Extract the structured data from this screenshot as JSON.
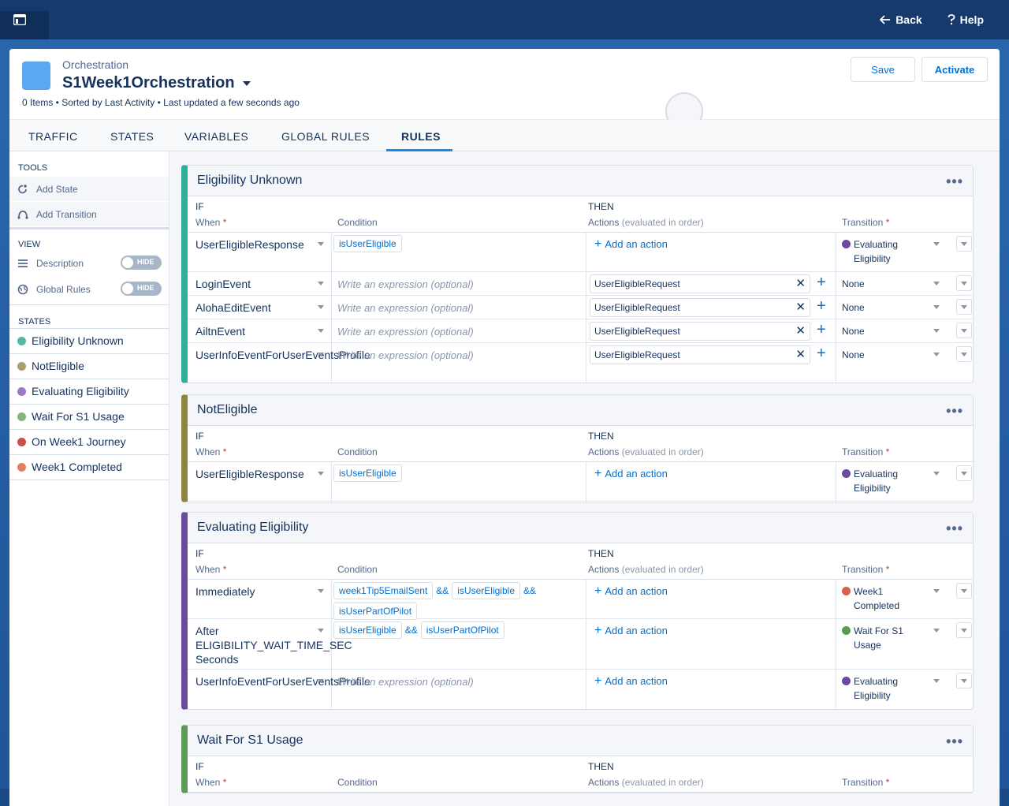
{
  "topnav": {
    "back_label": "Back",
    "help_label": "Help"
  },
  "header": {
    "object_type": "Orchestration",
    "title": "S1Week1Orchestration",
    "meta": "0 Items • Sorted by Last Activity • Last updated a few seconds ago",
    "save_label": "Save",
    "activate_label": "Activate"
  },
  "tabs": [
    "TRAFFIC",
    "STATES",
    "VARIABLES",
    "GLOBAL RULES",
    "RULES"
  ],
  "active_tab": "RULES",
  "sidebar": {
    "tools_heading": "TOOLS",
    "tools": [
      "Add State",
      "Add Transition"
    ],
    "view_heading": "VIEW",
    "view": [
      {
        "label": "Description",
        "toggle": "HIDE"
      },
      {
        "label": "Global Rules",
        "toggle": "HIDE"
      }
    ],
    "states_heading": "STATES",
    "states": [
      {
        "label": "Eligibility Unknown",
        "color": "#55b8a2"
      },
      {
        "label": "NotEligible",
        "color": "#a8a071"
      },
      {
        "label": "Evaluating Eligibility",
        "color": "#9b7bc4"
      },
      {
        "label": "Wait For S1 Usage",
        "color": "#85b47e"
      },
      {
        "label": "On Week1 Journey",
        "color": "#c6504a"
      },
      {
        "label": "Week1 Completed",
        "color": "#e07f62"
      }
    ]
  },
  "labels": {
    "if": "IF",
    "then": "THEN",
    "when": "When",
    "condition": "Condition",
    "actions": "Actions",
    "actions_note": "(evaluated in order)",
    "transition": "Transition",
    "required": "*",
    "placeholder": "Write an expression (optional)",
    "add_action": "Add an action",
    "more": "•••"
  },
  "cards": [
    {
      "title": "Eligibility Unknown",
      "color": "#2fae9d",
      "rows": [
        {
          "when": "UserEligibleResponse",
          "cond": [
            "isUserEligible"
          ],
          "action": null,
          "transition": "Evaluating Eligibility",
          "tcolor": "#6b4a9e"
        },
        {
          "when": "LoginEvent",
          "cond": null,
          "action": "UserEligibleRequest",
          "transition": "None",
          "tcolor": null
        },
        {
          "when": "AlohaEditEvent",
          "cond": null,
          "action": "UserEligibleRequest",
          "transition": "None",
          "tcolor": null
        },
        {
          "when": "AiltnEvent",
          "cond": null,
          "action": "UserEligibleRequest",
          "transition": "None",
          "tcolor": null
        },
        {
          "when": "UserInfoEventForUserEventsProfile",
          "cond": null,
          "action": "UserEligibleRequest",
          "transition": "None",
          "tcolor": null
        }
      ]
    },
    {
      "title": "NotEligible",
      "color": "#8f8440",
      "rows": [
        {
          "when": "UserEligibleResponse",
          "cond": [
            "isUserEligible"
          ],
          "action": null,
          "transition": "Evaluating Eligibility",
          "tcolor": "#6b4a9e"
        }
      ]
    },
    {
      "title": "Evaluating Eligibility",
      "color": "#6b4a9e",
      "rows": [
        {
          "when": "Immediately",
          "cond": [
            "week1Tip5EmailSent",
            "&&",
            "isUserEligible",
            "&&",
            "isUserPartOfPilot"
          ],
          "action": null,
          "transition": "Week1 Completed",
          "tcolor": "#d4624a"
        },
        {
          "when": "After ELIGIBILITY_WAIT_TIME_SEC Seconds",
          "cond": [
            "isUserEligible",
            "&&",
            "isUserPartOfPilot"
          ],
          "action": null,
          "transition": "Wait For S1 Usage",
          "tcolor": "#5c9b55"
        },
        {
          "when": "UserInfoEventForUserEventsProfile",
          "cond": null,
          "action": null,
          "transition": "Evaluating Eligibility",
          "tcolor": "#6b4a9e"
        }
      ]
    },
    {
      "title": "Wait For S1 Usage",
      "color": "#5c9b55",
      "rows": []
    }
  ]
}
